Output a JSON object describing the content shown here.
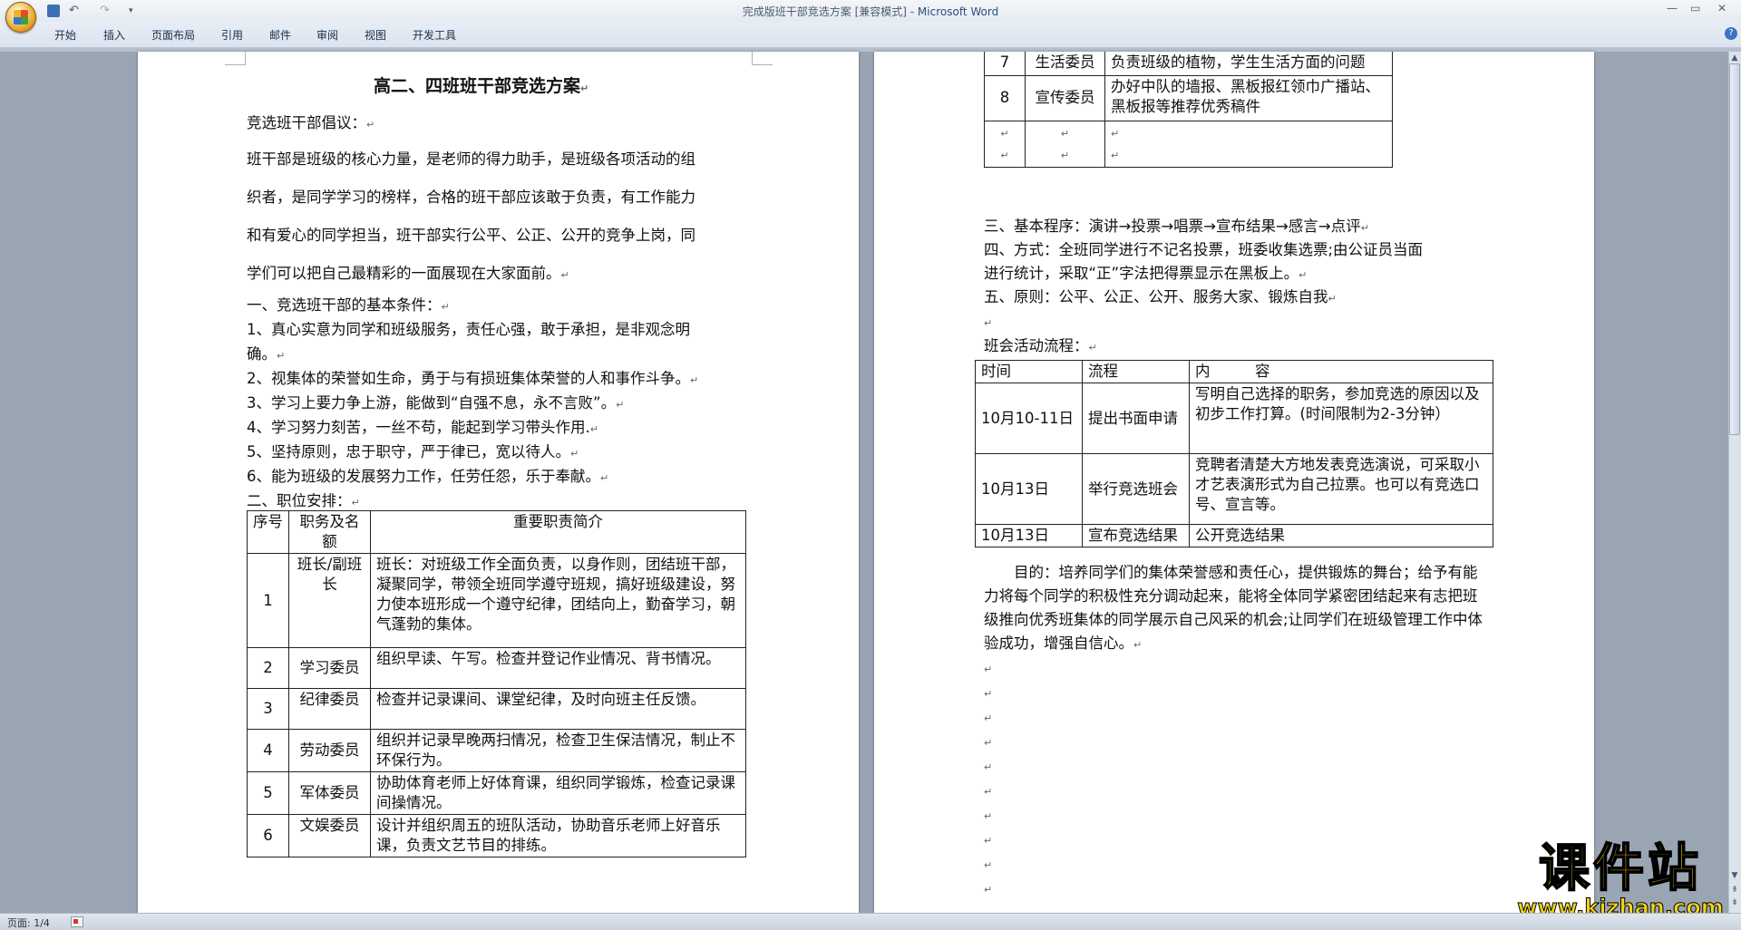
{
  "window": {
    "title_doc": "完成版班干部竞选方案 [兼容模式] - ",
    "title_app": "Microsoft Word"
  },
  "ribbon": {
    "tabs": [
      "开始",
      "插入",
      "页面布局",
      "引用",
      "邮件",
      "审阅",
      "视图",
      "开发工具"
    ]
  },
  "status": {
    "page": "页面: 1/4"
  },
  "doc_left": {
    "title": "高二、四班班干部竞选方案",
    "intro_heading": "竞选班干部倡议：",
    "intro_lines": [
      "班干部是班级的核心力量，是老师的得力助手，是班级各项活动的组",
      "织者，是同学学习的榜样，合格的班干部应该敢于负责，有工作能力",
      "和有爱心的同学担当，班干部实行公平、公正、公开的竞争上岗，同",
      "学们可以把自己最精彩的一面展现在大家面前。"
    ],
    "cond_heading": " 一、竞选班干部的基本条件：",
    "conditions": [
      "1、真心实意为同学和班级服务，责任心强，敢于承担，是非观念明",
      "确。",
      "2、视集体的荣誉如生命，勇于与有损班集体荣誉的人和事作斗争。",
      "3、学习上要力争上游，能做到“自强不息，永不言败”。",
      "4、学习努力刻苦，一丝不苟，能起到学习带头作用.",
      "5、坚持原则，忠于职守，严于律已，宽以待人。",
      "6、能为班级的发展努力工作，任劳任怨，乐于奉献。"
    ],
    "pos_heading": "二、职位安排：",
    "table_headers": [
      "序号",
      "职务及名额",
      "重要职责简介"
    ],
    "positions": [
      {
        "no": "1",
        "role": "班长/副班长",
        "duty": "班长：对班级工作全面负责，以身作则，团结班干部，凝聚同学，带领全班同学遵守班规，搞好班级建设，努力使本班形成一个遵守纪律，团结向上，勤奋学习，朝气蓬勃的集体。"
      },
      {
        "no": "2",
        "role": "学习委员",
        "duty": "组织早读、午写。检查并登记作业情况、背书情况。"
      },
      {
        "no": "3",
        "role": "纪律委员",
        "duty": "检查并记录课间、课堂纪律，及时向班主任反馈。"
      },
      {
        "no": "4",
        "role": "劳动委员",
        "duty": "组织并记录早晚两扫情况，检查卫生保洁情况，制止不环保行为。"
      },
      {
        "no": "5",
        "role": "军体委员",
        "duty": "协助体育老师上好体育课，组织同学锻炼，检查记录课间操情况。"
      },
      {
        "no": "6",
        "role": "文娱委员",
        "duty": "设计并组织周五的班队活动，协助音乐老师上好音乐课，负责文艺节目的排练。"
      }
    ]
  },
  "doc_right": {
    "positions_cont": [
      {
        "no": "7",
        "role": "生活委员",
        "duty": "负责班级的植物，学生生活方面的问题"
      },
      {
        "no": "8",
        "role": "宣传委员",
        "duty": "办好中队的墙报、黑板报红领巾广播站、黑板报等推荐优秀稿件"
      }
    ],
    "procedure": "三、基本程序：演讲→投票→唱票→宣布结果→感言→点评",
    "method_1": "四、方式：全班同学进行不记名投票，班委收集选票;由公证员当面",
    "method_2": "进行统计，采取“正”字法把得票显示在黑板上。",
    "principle": "五、原则：公平、公正、公开、服务大家、锻炼自我",
    "flow_heading": "班会活动流程：",
    "flow_headers": [
      "时间",
      "流程",
      "内　　　容"
    ],
    "flow": [
      {
        "time": "10月10-11日",
        "step": "提出书面申请",
        "content": "写明自己选择的职务，参加竞选的原因以及初步工作打算。(时间限制为2-3分钟）"
      },
      {
        "time": "10月13日",
        "step": "举行竞选班会",
        "content": "竞聘者清楚大方地发表竞选演说，可采取小才艺表演形式为自己拉票。也可以有竞选口号、宣言等。"
      },
      {
        "time": "10月13日",
        "step": "宣布竞选结果",
        "content": "公开竞选结果"
      }
    ],
    "purpose": "目的：培养同学们的集体荣誉感和责任心，提供锻炼的舞台；给予有能力将每个同学的积极性充分调动起来，能将全体同学紧密团结起来有志把班级推向优秀班集体的同学展示自己风采的机会;让同学们在班级管理工作中体验成功，增强自信心。"
  },
  "watermark": {
    "main": "课件站",
    "sub": "www.kjzhan.com"
  }
}
